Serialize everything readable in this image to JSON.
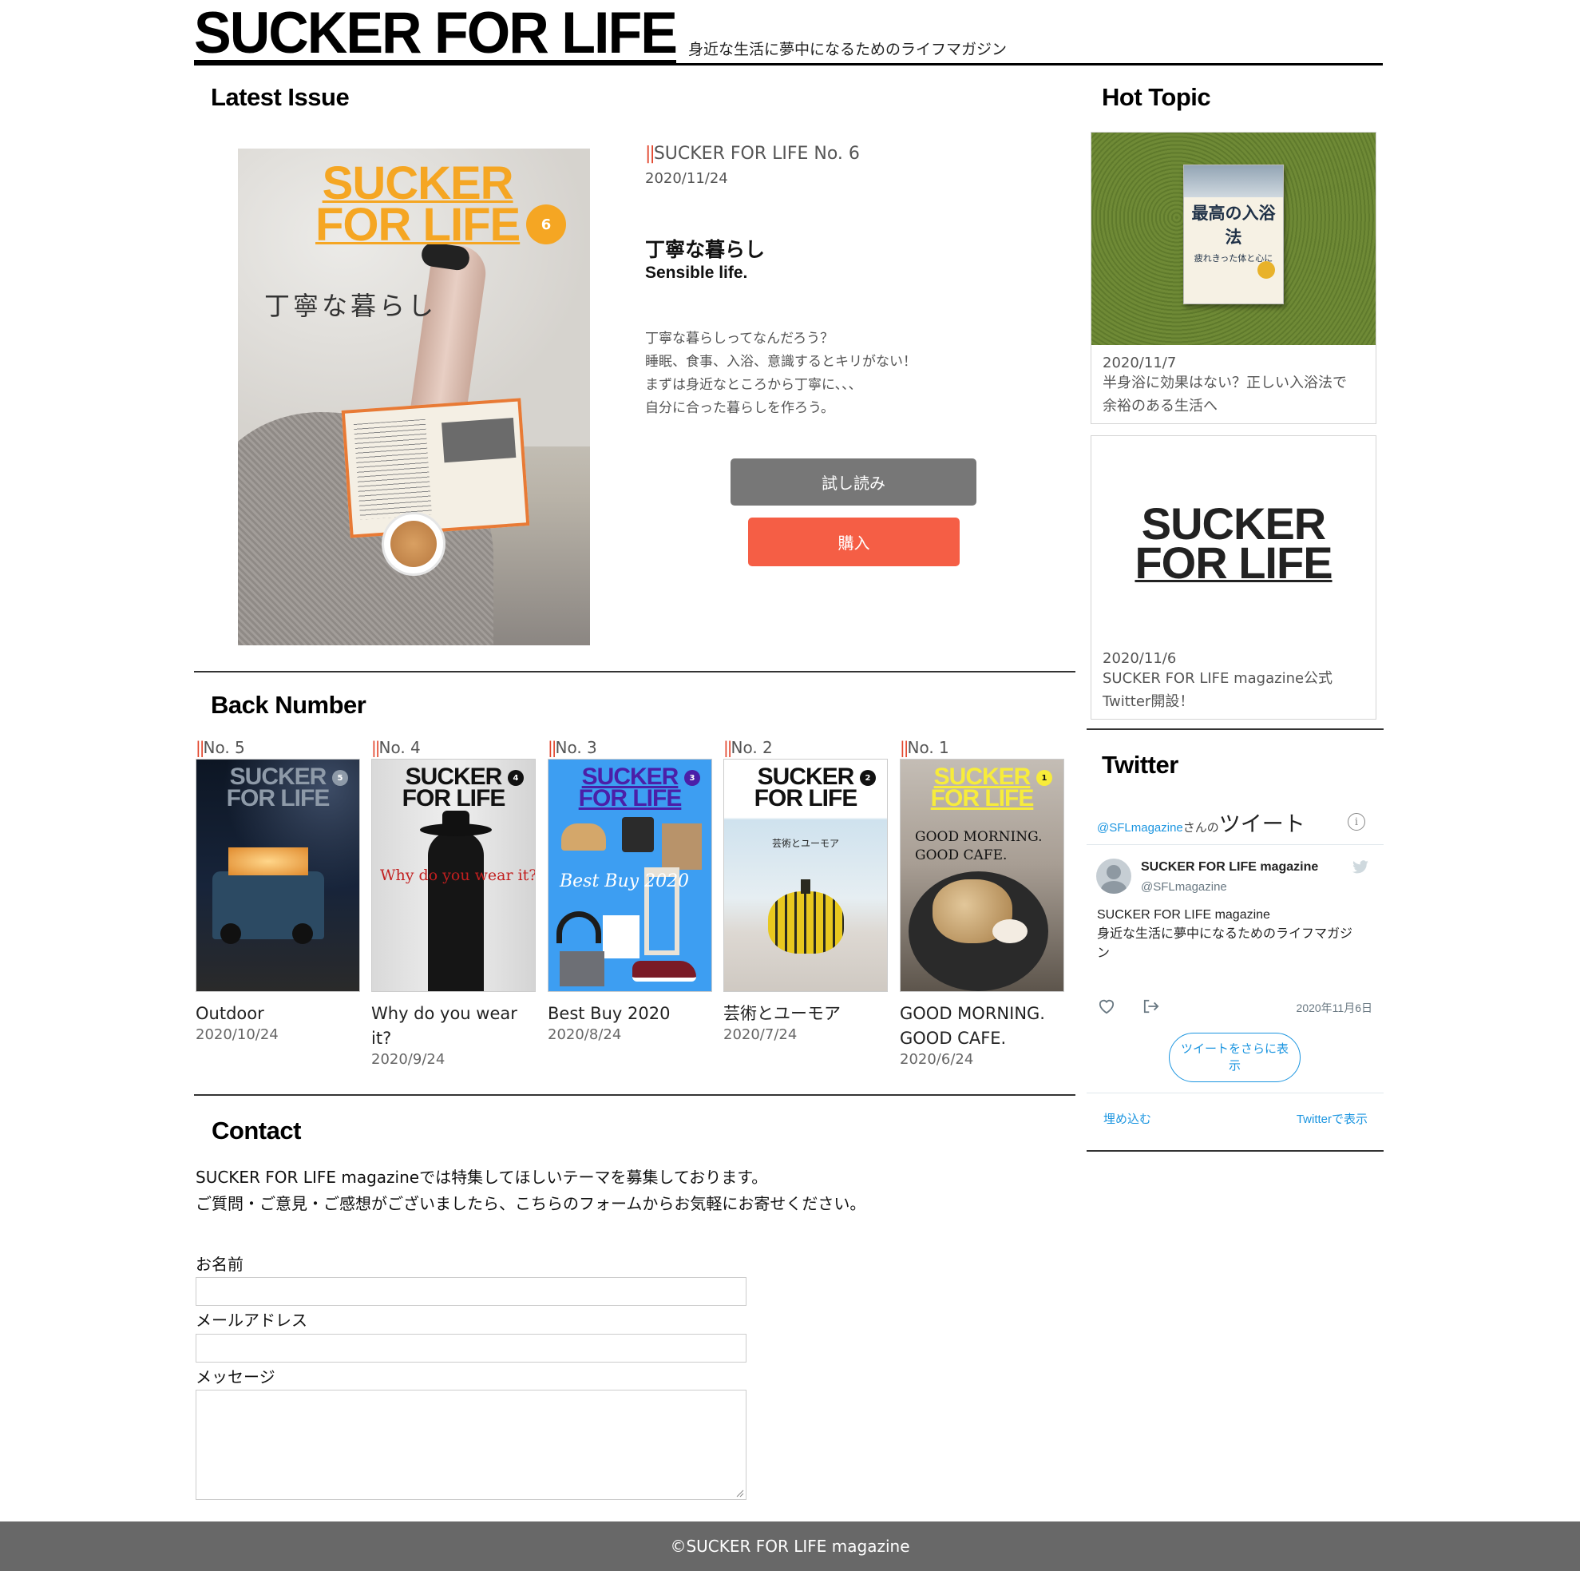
{
  "header": {
    "logo": "SUCKER FOR LIFE",
    "tagline": "身近な生活に夢中になるためのライフマガジン"
  },
  "latest": {
    "section_title": "Latest Issue",
    "cover_logo_line1": "SUCKER",
    "cover_logo_line2": "FOR LIFE",
    "cover_badge": "6",
    "cover_caption": "丁寧な暮らし",
    "mark": "||",
    "issue_name": "SUCKER FOR LIFE No. 6",
    "date": "2020/11/24",
    "title_jp": "丁寧な暮らし",
    "title_en": "Sensible life.",
    "description": [
      "丁寧な暮らしってなんだろう？",
      "睡眠、食事、入浴、意識するとキリがない！",
      "まずは身近なところから丁寧に、、、",
      "自分に合った暮らしを作ろう。"
    ],
    "preview_button": "試し読み",
    "buy_button": "購入"
  },
  "back_number": {
    "section_title": "Back Number",
    "mark": "||",
    "cover_logo_line1": "SUCKER",
    "cover_logo_line2": "FOR LIFE",
    "items": [
      {
        "no": "No. 5",
        "badge": "5",
        "title": "Outdoor",
        "title2": "",
        "date": "2020/10/24",
        "cover_text": ""
      },
      {
        "no": "No. 4",
        "badge": "4",
        "title": "Why do you wear it?",
        "title2": "",
        "date": "2020/9/24",
        "cover_text": "Why do you wear it?"
      },
      {
        "no": "No. 3",
        "badge": "3",
        "title": "Best Buy 2020",
        "title2": "",
        "date": "2020/8/24",
        "cover_text": "Best Buy 2020"
      },
      {
        "no": "No. 2",
        "badge": "2",
        "title": "芸術とユーモア",
        "title2": "",
        "date": "2020/7/24",
        "cover_text": "芸術とユーモア"
      },
      {
        "no": "No. 1",
        "badge": "1",
        "title": "GOOD MORNING.",
        "title2": "GOOD CAFE.",
        "date": "2020/6/24",
        "cover_text": "GOOD MORNING.",
        "cover_text2": "GOOD CAFE."
      }
    ]
  },
  "contact": {
    "section_title": "Contact",
    "intro": [
      "SUCKER FOR LIFE magazineでは特集してほしいテーマを募集しております。",
      "ご質問・ご意見・ご感想がございましたら、こちらのフォームからお気軽にお寄せください。"
    ],
    "name_label": "お名前",
    "email_label": "メールアドレス",
    "message_label": "メッセージ"
  },
  "hot_topic": {
    "section_title": "Hot Topic",
    "cards": [
      {
        "date": "2020/11/7",
        "lines": [
          "半身浴に効果はない？正しい入浴法で",
          "余裕のある生活へ"
        ],
        "book_title": "最高の入浴法",
        "book_sub": "疲れきった体と心に"
      },
      {
        "date": "2020/11/6",
        "lines": [
          "SUCKER FOR LIFE magazine公式",
          "Twitter開設！"
        ],
        "logo_line1": "SUCKER",
        "logo_line2": "FOR LIFE"
      }
    ]
  },
  "twitter": {
    "section_title": "Twitter",
    "handle_link": "@SFLmagazine",
    "handle_suffix": "さんの",
    "tweets_label": "ツイート",
    "account_name": "SUCKER FOR LIFE magazine",
    "account_handle": "@SFLmagazine",
    "tweet_line1": "SUCKER FOR LIFE magazine",
    "tweet_line2": "身近な生活に夢中になるためのライフマガジ",
    "tweet_line3": "ン",
    "tweet_date": "2020年11月6日",
    "more_button_line1": "ツイートをさらに表",
    "more_button_line2": "示",
    "embed_link": "埋め込む",
    "view_link": "Twitterで表示"
  },
  "footer": {
    "copyright": "©SUCKER FOR LIFE magazine"
  },
  "colors": {
    "accent_red": "#e2452c",
    "buy_button": "#f55e45",
    "preview_button": "#777777",
    "footer_bg": "#686868",
    "twitter_blue": "#1b95e0",
    "cover_yellow": "#f5a623"
  }
}
